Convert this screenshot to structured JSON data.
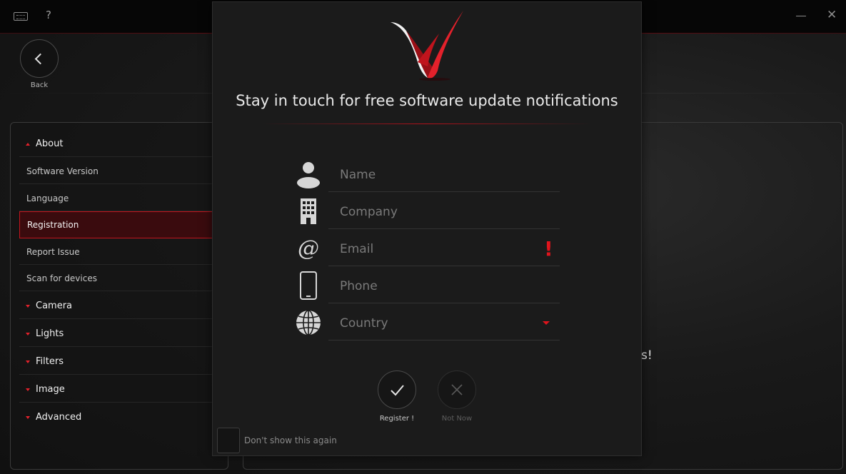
{
  "window": {
    "help_label": "?",
    "close_label": "✕"
  },
  "nav": {
    "back_label": "Back"
  },
  "sidebar": {
    "items": [
      {
        "label": "About",
        "type": "section",
        "expanded": true
      },
      {
        "label": "Software Version",
        "type": "item"
      },
      {
        "label": "Language",
        "type": "item"
      },
      {
        "label": "Registration",
        "type": "item",
        "selected": true
      },
      {
        "label": "Report Issue",
        "type": "item"
      },
      {
        "label": "Scan for devices",
        "type": "item"
      },
      {
        "label": "Camera",
        "type": "section",
        "expanded": false
      },
      {
        "label": "Lights",
        "type": "section",
        "expanded": false
      },
      {
        "label": "Filters",
        "type": "section",
        "expanded": false
      },
      {
        "label": "Image",
        "type": "section",
        "expanded": false
      },
      {
        "label": "Advanced",
        "type": "section",
        "expanded": false
      }
    ]
  },
  "main": {
    "partial_text": "s!"
  },
  "modal": {
    "title": "Stay in touch for free software update notifications",
    "fields": [
      {
        "placeholder": "Name",
        "icon": "person-icon",
        "value": ""
      },
      {
        "placeholder": "Company",
        "icon": "building-icon",
        "value": ""
      },
      {
        "placeholder": "Email",
        "icon": "at-sign-icon",
        "value": "",
        "error": "!"
      },
      {
        "placeholder": "Phone",
        "icon": "phone-icon",
        "value": ""
      },
      {
        "placeholder": "Country",
        "icon": "globe-icon",
        "value": "",
        "dropdown": true
      }
    ],
    "register_label": "Register !",
    "not_now_label": "Not Now",
    "dont_show_label": "Don't show this again"
  },
  "colors": {
    "accent": "#e0141c",
    "background": "#141414",
    "panel": "#1b1b1b"
  }
}
